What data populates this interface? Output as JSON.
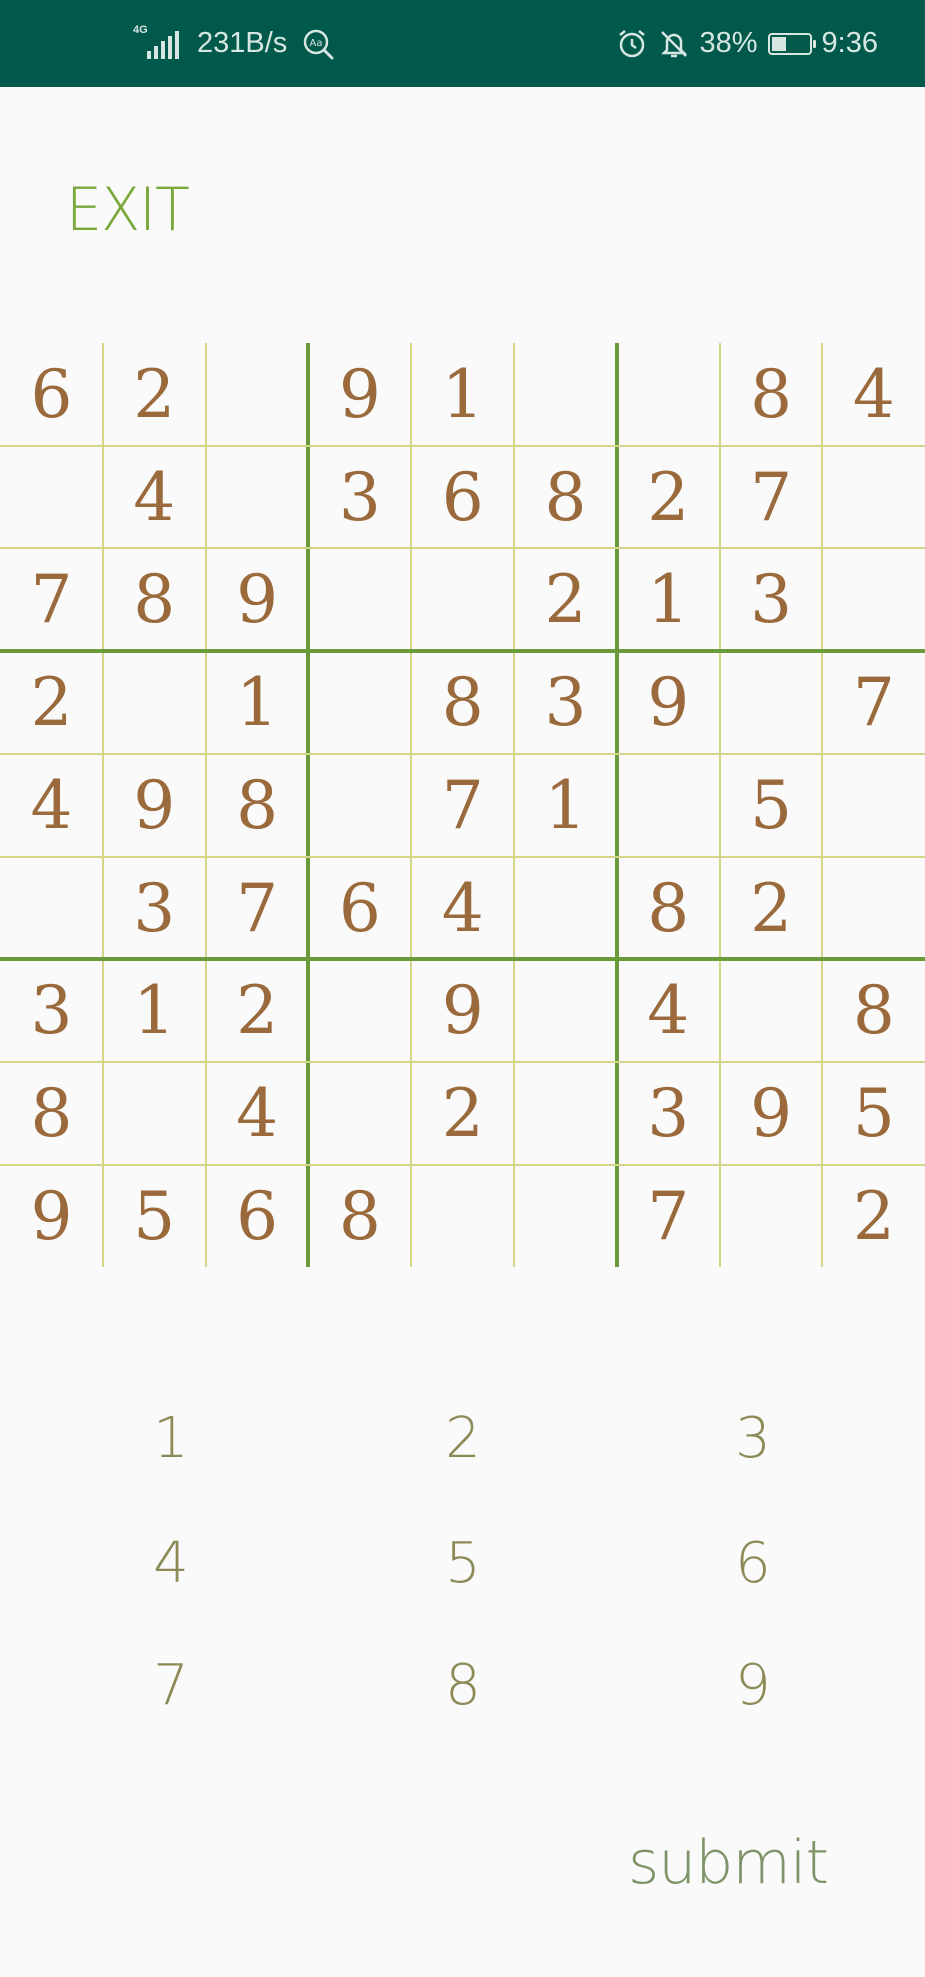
{
  "status_bar": {
    "network_type": "4G",
    "speed": "231B/s",
    "battery_level": "38%",
    "battery_fraction": 0.38,
    "time": "9:36",
    "colors": {
      "background": "#00594b",
      "text": "#d7e6e1"
    },
    "icons": [
      "signal-icon",
      "magnifier-icon",
      "alarm-icon",
      "notifications-off-icon",
      "battery-icon"
    ]
  },
  "header": {
    "exit_label": "EXIT"
  },
  "board": {
    "grid": [
      [
        "6",
        "2",
        "",
        "9",
        "1",
        "",
        "",
        "8",
        "4"
      ],
      [
        "",
        "4",
        "",
        "3",
        "6",
        "8",
        "2",
        "7",
        ""
      ],
      [
        "7",
        "8",
        "9",
        "",
        "",
        "2",
        "1",
        "3",
        ""
      ],
      [
        "2",
        "",
        "1",
        "",
        "8",
        "3",
        "9",
        "",
        "7"
      ],
      [
        "4",
        "9",
        "8",
        "",
        "7",
        "1",
        "",
        "5",
        ""
      ],
      [
        "",
        "3",
        "7",
        "6",
        "4",
        "",
        "8",
        "2",
        ""
      ],
      [
        "3",
        "1",
        "2",
        "",
        "9",
        "",
        "4",
        "",
        "8"
      ],
      [
        "8",
        "",
        "4",
        "",
        "2",
        "",
        "3",
        "9",
        "5"
      ],
      [
        "9",
        "5",
        "6",
        "8",
        "",
        "",
        "7",
        "",
        "2"
      ]
    ],
    "colors": {
      "digit": "#9a6a3c",
      "thin_line": "#d5d587",
      "thick_line": "#6a9a3a"
    }
  },
  "keypad": {
    "keys": [
      "1",
      "2",
      "3",
      "4",
      "5",
      "6",
      "7",
      "8",
      "9"
    ]
  },
  "footer": {
    "submit_label": "submit"
  }
}
